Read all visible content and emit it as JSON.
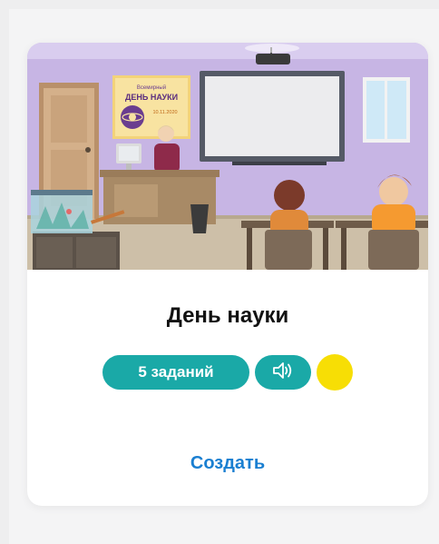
{
  "card": {
    "title": "День науки",
    "tasks_label": "5 заданий",
    "action_label": "Создать",
    "poster": {
      "line1": "Всемирный",
      "line2": "ДЕНЬ НАУКИ",
      "line3": "10.11.2020"
    }
  },
  "icons": {
    "audio": "speaker-icon",
    "status": "yellow-dot"
  },
  "colors": {
    "tag_bg": "#1aa9a7",
    "dot": "#f7de05",
    "link": "#1a7fd1"
  }
}
